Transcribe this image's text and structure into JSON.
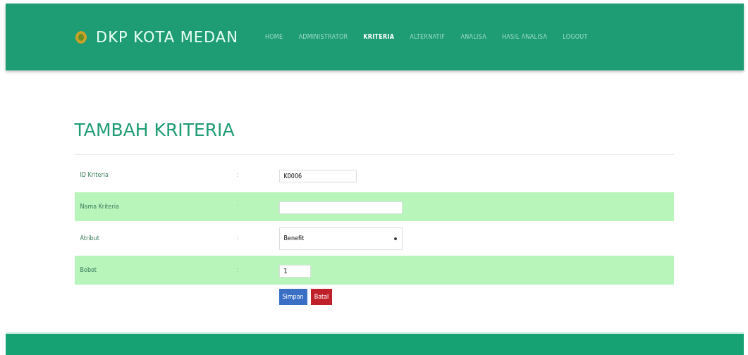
{
  "brand": "DKP KOTA MEDAN",
  "nav": [
    {
      "label": "HOME",
      "selected": false
    },
    {
      "label": "ADMINISTRATOR",
      "selected": false
    },
    {
      "label": "KRITERIA",
      "selected": true
    },
    {
      "label": "ALTERNATIF",
      "selected": false
    },
    {
      "label": "ANALISA",
      "selected": false
    },
    {
      "label": "HASIL ANALISA",
      "selected": false
    },
    {
      "label": "LOGOUT",
      "selected": false
    }
  ],
  "title": "TAMBAH KRITERIA",
  "rows": [
    {
      "label": "ID Kriteria",
      "sep": ":",
      "kind": "input",
      "value": "K0006"
    },
    {
      "label": "Nama Kriteria",
      "sep": ":",
      "kind": "input",
      "value": ""
    },
    {
      "label": "Atribut",
      "sep": ":",
      "kind": "select",
      "value": "Benefit"
    },
    {
      "label": "Bobot",
      "sep": ":",
      "kind": "input",
      "value": "1"
    }
  ],
  "buttons": [
    {
      "label": "Simpan",
      "kind": "primary"
    },
    {
      "label": "Batal",
      "kind": "danger"
    }
  ]
}
